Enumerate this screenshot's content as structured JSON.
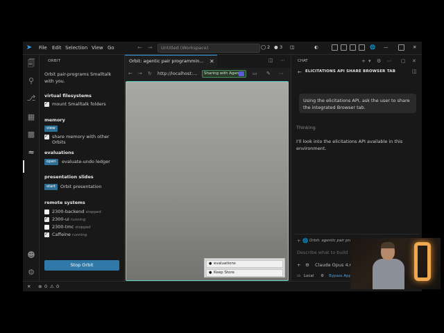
{
  "menu": {
    "file": "File",
    "edit": "Edit",
    "selection": "Selection",
    "view": "View",
    "go": "Go"
  },
  "titlebar": {
    "search_label": "Untitled (Workspace)",
    "badge_a": "2",
    "badge_b": "3"
  },
  "sidebar": {
    "title": "ORBIT",
    "intro": "Orbit pair-programs Smalltalk with you.",
    "sections": {
      "vfs": {
        "heading": "virtual filesystems",
        "mount_label": "mount Smalltalk folders",
        "mount_checked": true
      },
      "memory": {
        "heading": "memory",
        "tag": "view",
        "share_label": "share memory with other Orbits",
        "share_checked": true
      },
      "evaluations": {
        "heading": "evaluations",
        "tag": "open",
        "label": "evaluate-undo ledger"
      },
      "slides": {
        "heading": "presentation slides",
        "tag": "start",
        "label": "Orbit presentation"
      },
      "remote": {
        "heading": "remote systems",
        "items": [
          {
            "name": "2300-backend",
            "state": "stopped",
            "checked": false
          },
          {
            "name": "2300-ui",
            "state": "running",
            "checked": true
          },
          {
            "name": "2300-tmc",
            "state": "stopped",
            "checked": false
          },
          {
            "name": "Caffeine",
            "state": "running",
            "checked": true
          }
        ]
      }
    },
    "stop_button": "Stop Orbit"
  },
  "editor": {
    "tab_label": "Orbit: agentic pair programmin...",
    "url": "http://localhost:...",
    "share_pill": "Sharing with Agent",
    "palette": [
      "evaluations",
      "Keep Store"
    ]
  },
  "chat": {
    "panel_title": "CHAT",
    "header": "ELICITATIONS API SHARE BROWSER TAB",
    "user_message": "Using the elicitations API, ask the user to share the integrated Browser tab.",
    "thinking": "Thinking",
    "assistant_message": "I'll look into the elicitations API available in this environment.",
    "context_label": "Orbit: agentic pair programmi...",
    "input_placeholder": "Describe what to build",
    "model": "Claude Opus 4.6",
    "mode_local": "Local",
    "mode_bypass": "Bypass App..."
  },
  "statusbar": {
    "errors": "0",
    "warnings": "0"
  },
  "colors": {
    "accent": "#3b9fe8",
    "button": "#2f78a8",
    "tag": "#2f6f95",
    "webview_border": "#5dd6c7"
  }
}
